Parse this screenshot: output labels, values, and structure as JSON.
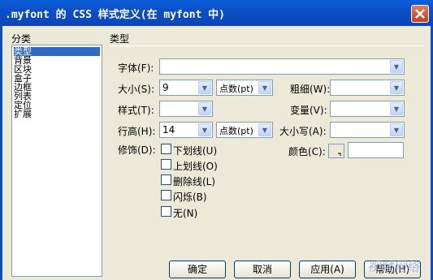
{
  "window": {
    "title": ".myfont 的 CSS 样式定义(在 myfont 中)"
  },
  "category": {
    "heading": "分类",
    "items": [
      "类型",
      "背景",
      "区块",
      "盒子",
      "边框",
      "列表",
      "定位",
      "扩展"
    ],
    "selected": "类型"
  },
  "panel": {
    "heading": "类型"
  },
  "fields": {
    "font": {
      "label": "字体(F):",
      "value": ""
    },
    "size": {
      "label": "大小(S):",
      "value": "9",
      "unit": "点数(pt)"
    },
    "weight": {
      "label": "粗细(W):",
      "value": ""
    },
    "style": {
      "label": "样式(T):",
      "value": ""
    },
    "variant": {
      "label": "变量(V):",
      "value": ""
    },
    "line_height": {
      "label": "行高(H):",
      "value": "14",
      "unit": "点数(pt)"
    },
    "case": {
      "label": "大小写(A):",
      "value": ""
    },
    "decoration": {
      "label": "修饰(D):",
      "options": [
        "下划线(U)",
        "上划线(O)",
        "删除线(L)",
        "闪烁(B)",
        "无(N)"
      ]
    },
    "color": {
      "label": "颜色(C):",
      "value": ""
    }
  },
  "buttons": {
    "ok": "确定",
    "cancel": "取消",
    "apply": "应用(A)",
    "help": "帮助(H)"
  },
  "watermark": "视频网络"
}
